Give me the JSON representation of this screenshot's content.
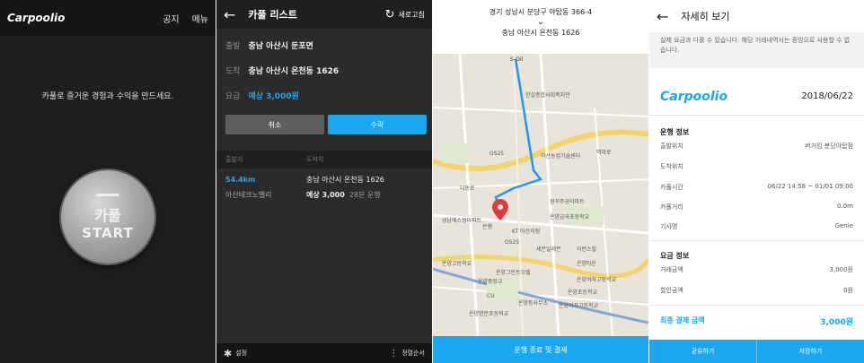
{
  "panel1": {
    "logo": "Carpoolio",
    "menu": [
      "공지",
      "메뉴"
    ],
    "tagline": "카풀로 즐거운 경험과 수익을 만드세요.",
    "start_korean": "카풀",
    "start_label": "START"
  },
  "panel2": {
    "title": "카풀 리스트",
    "refresh": "새로고침",
    "origin_label": "출발",
    "origin_value": "충남 아산시 둔포면",
    "dest_label": "도착",
    "dest_value": "충남 아산시 온천동 1626",
    "fare_label": "요금",
    "fare_value": "예상 3,000원",
    "cancel_label": "취소",
    "accept_label": "수락",
    "col_origin": "출발지",
    "col_dest": "도착지",
    "row1_left": "54.4km",
    "row1_right": "충남 아산시 온천동 1626",
    "row2_left": "아산테크노밸리",
    "row2_fare": "예상 3,000",
    "row2_time": "28분 운행",
    "settings": "설정",
    "sort": "정렬순서"
  },
  "panel3": {
    "from": "경기 성남시 분당구 야탑동 366-4",
    "to": "충남 아산시 온천동 1626",
    "finish": "운행 종료 및 결제",
    "map_labels": [
      "S-Oil",
      "한실종합사회복지관",
      "GS25",
      "아산농업기술센터",
      "역마로",
      "디동로",
      "성남에스쌍아파트",
      "원꾸주공아파트",
      "은행",
      "온양금곡초등학교",
      "KT 아산지점",
      "GS25",
      "세븐일레븐",
      "이런스빌",
      "온양고등학교",
      "온양그린트오텔",
      "온양여자고등학교",
      "온양중앙교",
      "온양타운",
      "온양초등학교",
      "온양여자고등학교",
      "CU",
      "온양동사무소",
      "온양명문초등학교"
    ]
  },
  "panel4": {
    "title": "자세히 보기",
    "notice": "실제 요금과 다를 수 있습니다. 해당 거래내역서는 증빙으로 사용할 수 없습니다.",
    "logo": "Carpoolio",
    "date": "2018/06/22",
    "section_ride": "운행 정보",
    "ride_rows": [
      {
        "label": "출발위치",
        "value": "버거킹 분당야탑점"
      },
      {
        "label": "도착위치",
        "value": ""
      },
      {
        "label": "카풀시간",
        "value": "06/22 14:58 ~ 01/01 09:00"
      },
      {
        "label": "카풀거리",
        "value": "0.0m"
      },
      {
        "label": "기사명",
        "value": "Genie"
      }
    ],
    "section_fare": "요금 정보",
    "fare_rows": [
      {
        "label": "거래금액",
        "value": "3,000원"
      },
      {
        "label": "할인금액",
        "value": "0원"
      }
    ],
    "total_label": "최종 결제 금액",
    "total_value": "3,000원",
    "left_button": "공유하기",
    "right_button": "저장하기"
  },
  "colors": {
    "accent": "#1aa7f0",
    "dark_bg": "#1e1e1e"
  }
}
